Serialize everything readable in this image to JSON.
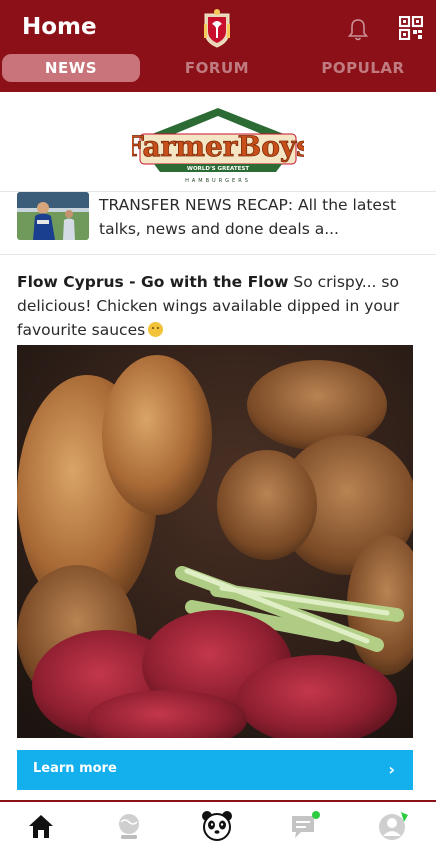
{
  "header": {
    "title": "Home",
    "tabs": [
      {
        "label": "NEWS",
        "active": true
      },
      {
        "label": "FORUM",
        "active": false
      },
      {
        "label": "POPULAR",
        "active": false
      }
    ],
    "icons": [
      "club-crest-icon",
      "bell-icon",
      "qr-code-icon"
    ]
  },
  "ad_banner": {
    "brand_word": "FarmerBoys",
    "tagline": "WORLD'S GREATEST",
    "subline": "HAMBURGERS"
  },
  "news_item": {
    "text": "TRANSFER NEWS RECAP: All the latest talks, news and done deals a..."
  },
  "sponsored_post": {
    "advertiser": "Flow Cyprus - Go with the Flow",
    "body": "So crispy... so delicious! Chicken wings available dipped in your favourite sauces",
    "cta_label": "Learn more",
    "cta_arrow": "›"
  },
  "bottom_nav": {
    "items": [
      "home-icon",
      "globe-icon",
      "panda-icon",
      "chat-icon",
      "profile-icon"
    ]
  },
  "colors": {
    "brand_red": "#8c1018",
    "active_tab": "#c9747a",
    "cta_blue": "#14b0ee",
    "badge_green": "#2ecc40"
  }
}
